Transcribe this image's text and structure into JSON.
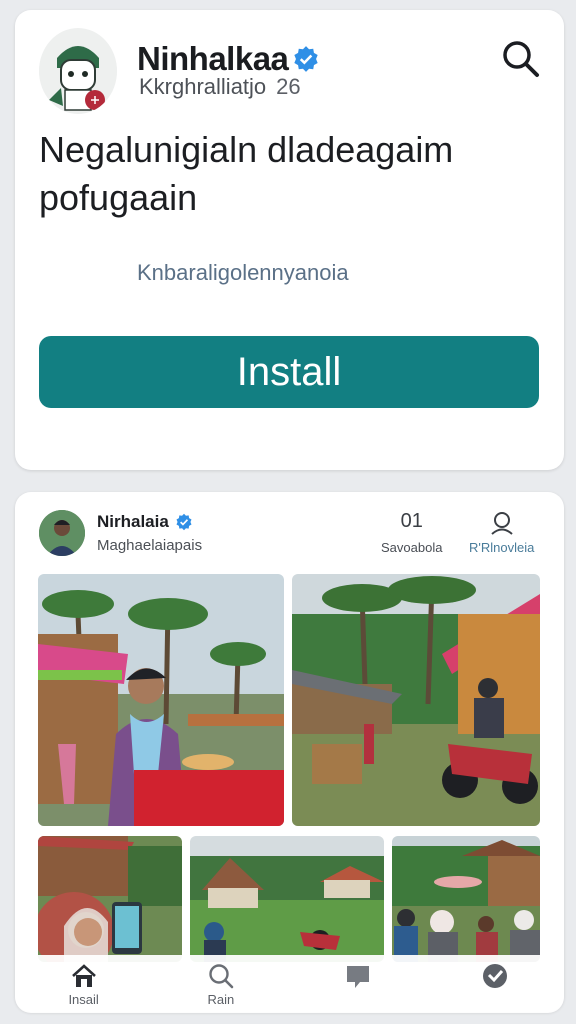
{
  "app": {
    "name": "Ninhalkaa",
    "subtitle": "Kkrghralliatjo",
    "count": "26",
    "headline": "Negalunigialn dladeagaim pofugaain",
    "link": "Knbaraligolennyanoia",
    "install_label": "Install"
  },
  "post": {
    "author": "Nirhalaia",
    "subtitle": "Maghaelaiapais",
    "stats": [
      {
        "icon": "number-icon",
        "value": "01",
        "label": "Savoabola"
      },
      {
        "icon": "user-icon",
        "label": "R'Rlnovleia"
      }
    ]
  },
  "nav": [
    {
      "icon": "home-icon",
      "label": "Insail"
    },
    {
      "icon": "search-icon",
      "label": "Rain"
    },
    {
      "icon": "chat-icon",
      "label": ""
    },
    {
      "icon": "check-icon",
      "label": ""
    }
  ],
  "colors": {
    "accent": "#127f82",
    "verified": "#2f8fe6",
    "background": "#e9ebee"
  }
}
